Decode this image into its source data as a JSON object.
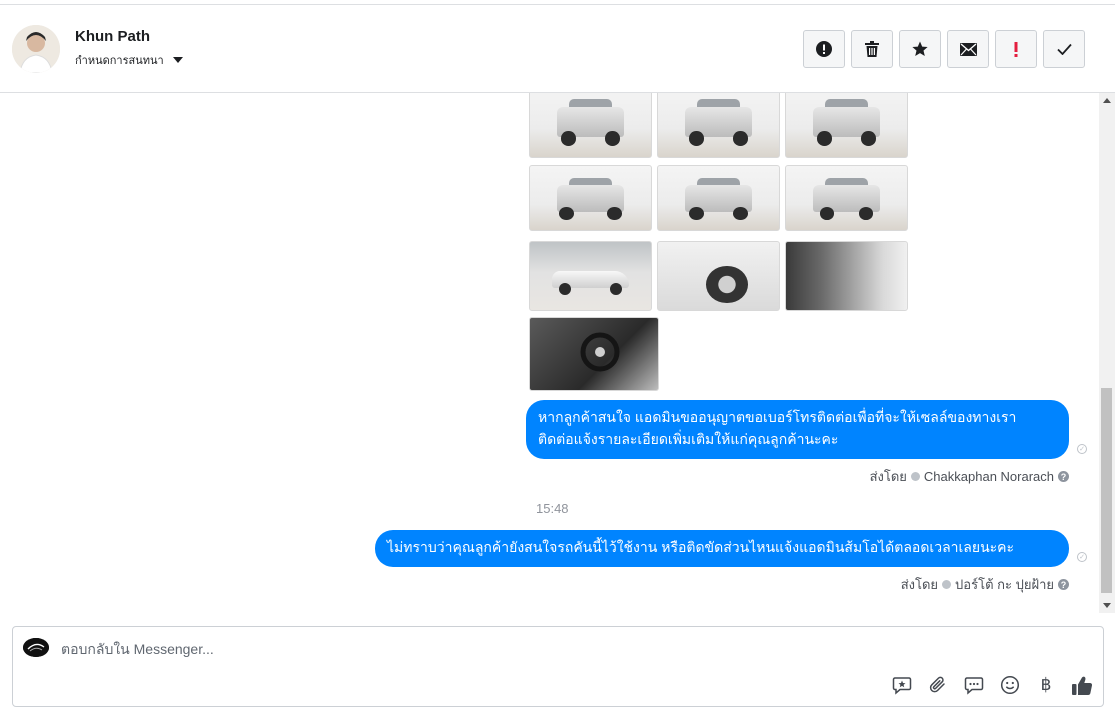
{
  "header": {
    "contact_name": "Khun Path",
    "conversation_status": "กำหนดการสนทนา",
    "actions": [
      "mark-spam",
      "delete",
      "star",
      "mark-unread",
      "follow-up",
      "done"
    ]
  },
  "messages": {
    "photo_grid_rows": 4,
    "bubble_1": "หากลูกค้าสนใจ แอดมินขออนุญาตขอเบอร์โทรติดต่อเพื่อที่จะให้เซลล์ของทางเรา ติดต่อแจ้งรายละเอียดเพิ่มเติมให้แก่คุณลูกค้านะคะ",
    "bubble_1_line1": "หากลูกค้าสนใจ แอดมินขออนุญาตขอเบอร์โทรติดต่อเพื่อที่จะให้เซลล์ของทางเรา",
    "bubble_1_line2": "ติดต่อแจ้งรายละเอียดเพิ่มเติมให้แก่คุณลูกค้านะคะ",
    "sent_by_label": "ส่งโดย",
    "sender_1": "Chakkaphan Norarach",
    "timestamp": "15:48",
    "bubble_2": "ไม่ทราบว่าคุณลูกค้ายังสนใจรถคันนี้ไว้ใช้งาน หรือติดขัดส่วนไหนแจ้งแอดมินส้มโอได้ตลอดเวลาเลยนะคะ",
    "sender_2": "ปอร์โต้ กะ ปุยฝ้าย"
  },
  "composer": {
    "placeholder": "ตอบกลับใน Messenger...",
    "tools": [
      "saved-reply-icon",
      "attach-icon",
      "chat-icon",
      "emoji-icon",
      "baht-icon",
      "like-icon"
    ],
    "baht_symbol": "฿"
  },
  "colors": {
    "bubble": "#0084ff",
    "border": "#ccd0d5"
  }
}
